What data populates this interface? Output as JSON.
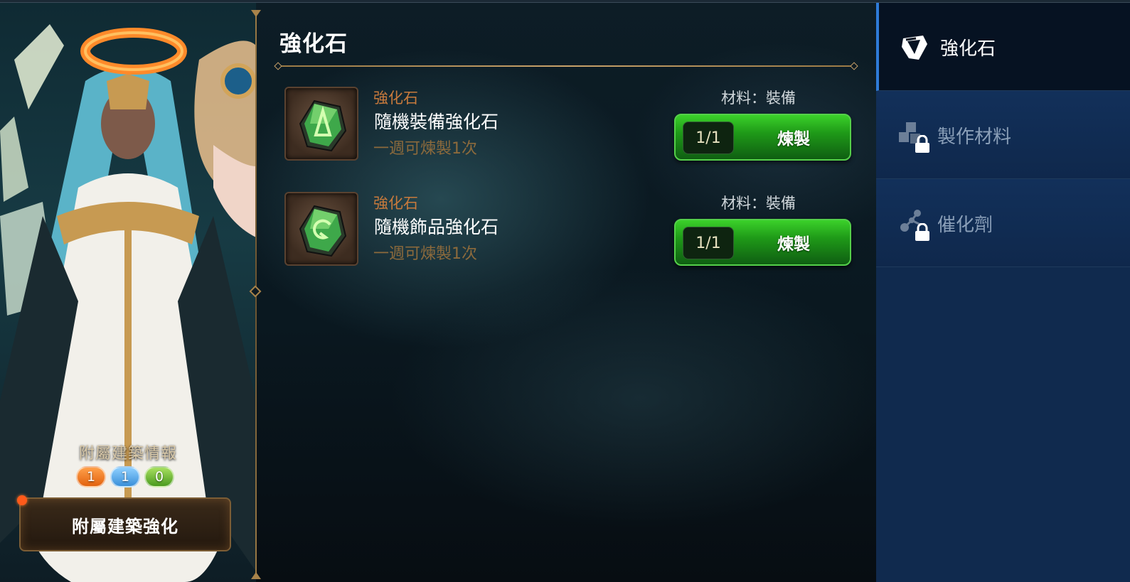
{
  "main": {
    "title": "強化石",
    "recipes": [
      {
        "category": "強化石",
        "name": "隨機裝備強化石",
        "limit": "一週可煉製1次",
        "material": "材料：裝備",
        "count": "1/1",
        "action": "煉製",
        "icon": "green-gem-arrow-icon"
      },
      {
        "category": "強化石",
        "name": "隨機飾品強化石",
        "limit": "一週可煉製1次",
        "material": "材料：裝備",
        "count": "1/1",
        "action": "煉製",
        "icon": "green-gem-swirl-icon"
      }
    ]
  },
  "annex": {
    "title": "附屬建築情報",
    "levels": [
      "1",
      "1",
      "0"
    ],
    "button_label": "附屬建築強化"
  },
  "side_menu": {
    "tabs": [
      {
        "label": "強化石",
        "icon": "enhance-stone-icon",
        "active": true,
        "locked": false
      },
      {
        "label": "製作材料",
        "icon": "materials-cubes-icon",
        "active": false,
        "locked": true
      },
      {
        "label": "催化劑",
        "icon": "catalyst-molecule-icon",
        "active": false,
        "locked": true
      }
    ]
  },
  "colors": {
    "accent_gold": "#9b7a45",
    "category_orange": "#c87a3c",
    "craft_green": "#1f9a18",
    "menu_blue": "#0f284c",
    "active_tab": "#061222"
  }
}
